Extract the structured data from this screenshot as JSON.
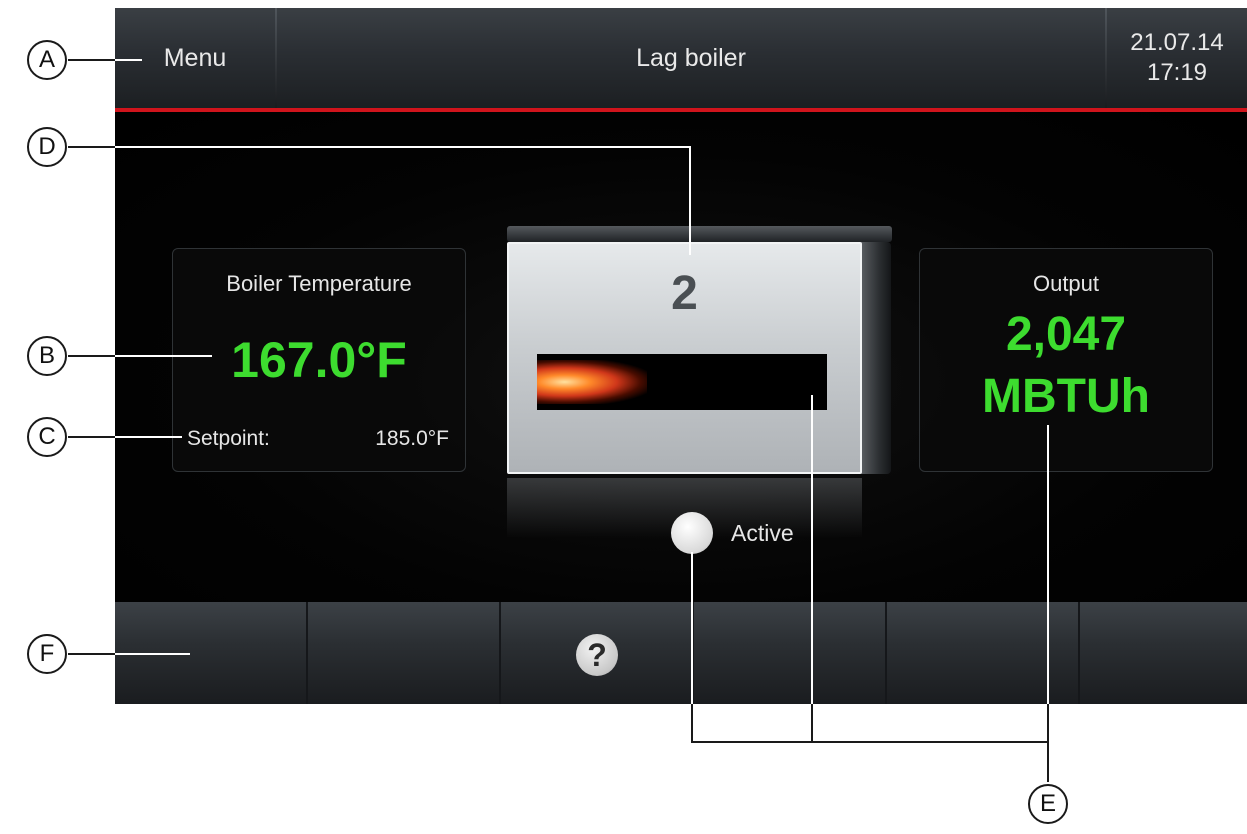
{
  "header": {
    "menu_label": "Menu",
    "title": "Lag boiler",
    "date": "21.07.14",
    "time": "17:19"
  },
  "boiler_temperature": {
    "label": "Boiler Temperature",
    "value": "167.0°F",
    "setpoint_label": "Setpoint:",
    "setpoint_value": "185.0°F"
  },
  "boiler": {
    "number": "2"
  },
  "output": {
    "label": "Output",
    "value": "2,047",
    "unit": "MBTUh"
  },
  "status": {
    "label": "Active"
  },
  "footer": {
    "help_icon": "help-icon"
  },
  "callouts": {
    "a": "A",
    "b": "B",
    "c": "C",
    "d": "D",
    "e": "E",
    "f": "F"
  },
  "colors": {
    "value_green": "#3ddc2f",
    "header_red_line": "#d0141c"
  }
}
